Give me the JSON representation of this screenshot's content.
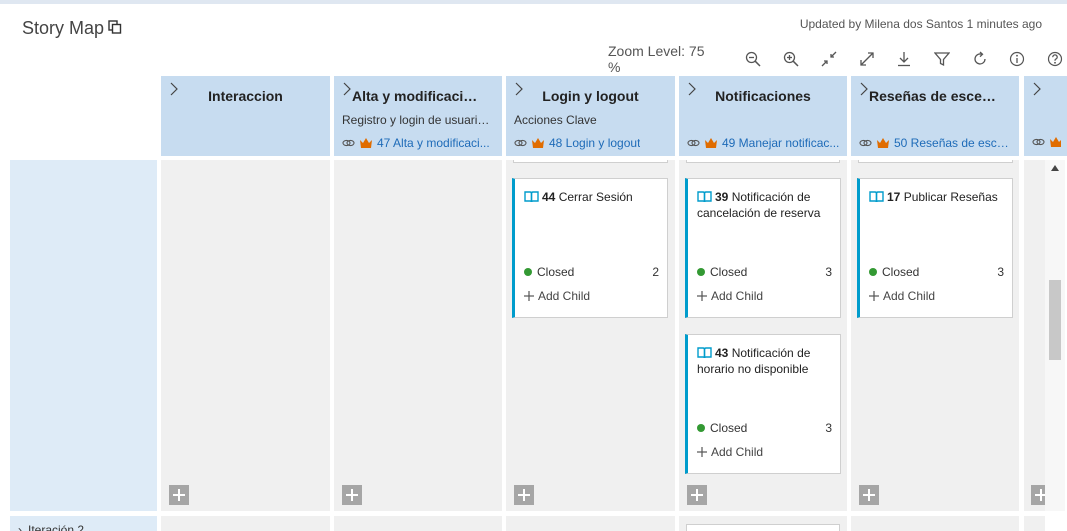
{
  "page": {
    "title": "Story Map",
    "updated": "Updated by Milena dos Santos 1 minutes ago"
  },
  "toolbar": {
    "zoom_label": "Zoom Level: 75 %"
  },
  "columns": [
    {
      "title": "Interaccion",
      "subtitle": "",
      "parent": ""
    },
    {
      "title": "Alta y modificacion ...",
      "subtitle": "Registro y login de usuario...",
      "parent": "47 Alta y modificaci..."
    },
    {
      "title": "Login y logout",
      "subtitle": "Acciones Clave",
      "parent": "48 Login y logout"
    },
    {
      "title": "Notificaciones",
      "subtitle": "",
      "parent": "49 Manejar notificac..."
    },
    {
      "title": "Reseñas de escenari...",
      "subtitle": "",
      "parent": "50 Reseñas de escen..."
    }
  ],
  "cards": [
    {
      "id": "44",
      "title": "Cerrar Sesión",
      "state": "Closed",
      "count": "2",
      "add_child": "Add Child"
    },
    {
      "id": "39",
      "title": "Notificación de cancelación de reserva",
      "state": "Closed",
      "count": "3",
      "add_child": "Add Child"
    },
    {
      "id": "43",
      "title": "Notificación de horario no disponible",
      "state": "Closed",
      "count": "3",
      "add_child": "Add Child"
    },
    {
      "id": "17",
      "title": "Publicar Reseñas",
      "state": "Closed",
      "count": "3",
      "add_child": "Add Child"
    }
  ],
  "bottom_row": {
    "label": "Iteración 2"
  },
  "colors": {
    "header_bg": "#c7dcf0",
    "lane_bg": "#deebf7",
    "card_accent": "#009ccc",
    "closed_dot": "#339933",
    "crown": "#e06c00",
    "link": "#1e6bb8"
  }
}
